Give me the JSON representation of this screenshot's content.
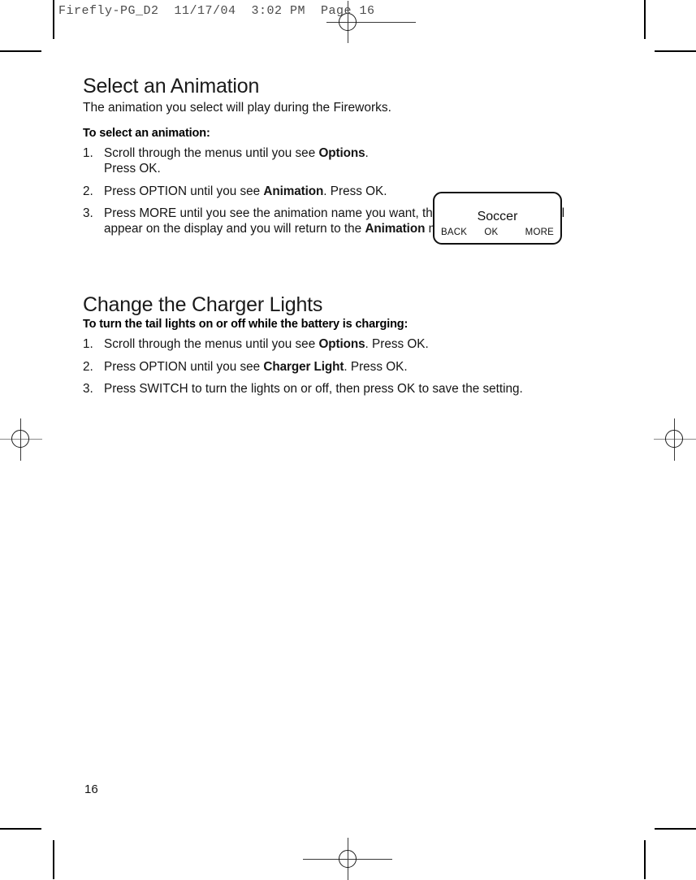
{
  "printer_marks": {
    "file_stamp": "Firefly-PG_D2  11/17/04  3:02 PM  Page 16"
  },
  "sections": [
    {
      "title": "Select an Animation",
      "lede": "The animation you select will play during the Fireworks.",
      "sub_heading": "To select an animation:",
      "steps": [
        {
          "num": "1.",
          "parts": [
            {
              "text": "Scroll through the menus until you see ",
              "bold": false
            },
            {
              "text": "Options",
              "bold": true
            },
            {
              "text": ".",
              "bold": false
            },
            {
              "text": "\nPress OK.",
              "bold": false
            }
          ]
        },
        {
          "num": "2.",
          "parts": [
            {
              "text": "Press OPTION until you see ",
              "bold": false
            },
            {
              "text": "Animation",
              "bold": true
            },
            {
              "text": ". Press OK.",
              "bold": false
            }
          ]
        },
        {
          "num": "3.",
          "parts": [
            {
              "text": "Press MORE until you see the animation name you want, then press OK. Saved will appear on the display and you will return to the ",
              "bold": false
            },
            {
              "text": "Animation",
              "bold": true
            },
            {
              "text": " menu.",
              "bold": false
            }
          ]
        }
      ]
    },
    {
      "title": "Change the Charger Lights",
      "lede": "",
      "sub_heading": "To turn the tail lights on or off while the battery is charging:",
      "steps": [
        {
          "num": "1.",
          "parts": [
            {
              "text": "Scroll through the menus until you see ",
              "bold": false
            },
            {
              "text": "Options",
              "bold": true
            },
            {
              "text": ". Press OK.",
              "bold": false
            }
          ]
        },
        {
          "num": "2.",
          "parts": [
            {
              "text": "Press OPTION until you see ",
              "bold": false
            },
            {
              "text": "Charger Light",
              "bold": true
            },
            {
              "text": ". Press OK.",
              "bold": false
            }
          ]
        },
        {
          "num": "3.",
          "parts": [
            {
              "text": "Press SWITCH to turn the lights on or off, then press OK to save the setting.",
              "bold": false
            }
          ]
        }
      ]
    }
  ],
  "lcd_display": {
    "main_text": "Soccer",
    "softkey_left": "BACK",
    "softkey_center": "OK",
    "softkey_right": "MORE"
  },
  "folio": "16"
}
